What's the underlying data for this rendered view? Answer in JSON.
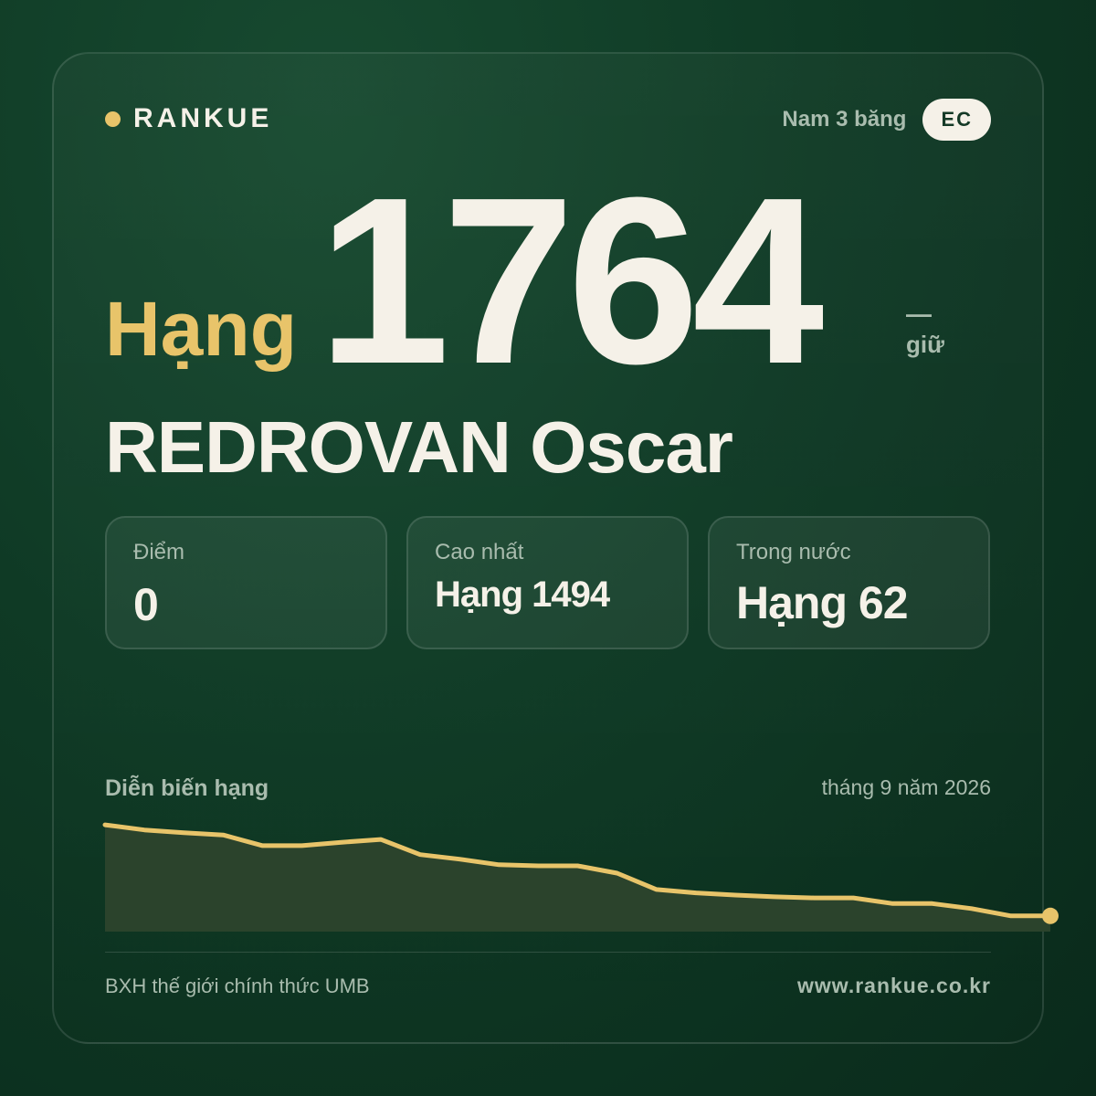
{
  "brand": {
    "name": "RANKUE",
    "dot_color": "#e8c46a"
  },
  "meta": {
    "category": "Nam 3 băng",
    "badge": "EC"
  },
  "rank": {
    "prefix": "Hạng",
    "number": "1764",
    "change_symbol": "—",
    "change_label": "giữ"
  },
  "player": {
    "name": "REDROVAN Oscar"
  },
  "stats": [
    {
      "label": "Điểm",
      "value": "0"
    },
    {
      "label": "Cao nhất",
      "value": "Hạng 1494"
    },
    {
      "label": "Trong nước",
      "value": "Hạng 62"
    }
  ],
  "chart": {
    "title": "Diễn biến hạng",
    "date": "tháng 9 năm 2026"
  },
  "chart_data": {
    "type": "area",
    "series": [
      {
        "values": [
          1,
          1.9,
          2.4,
          2.8,
          4.7,
          4.7,
          4.1,
          3.6,
          6.3,
          7.1,
          8.1,
          8.3,
          8.3,
          9.6,
          12.5,
          13.1,
          13.5,
          13.8,
          14.0,
          14.0,
          15.0,
          15.0,
          15.9,
          17.2,
          17.2
        ]
      }
    ],
    "accent_color": "#e8c46a",
    "fill_color": "#2b432c",
    "grid": false
  },
  "footer": {
    "source": "BXH thế giới chính thức UMB",
    "url": "www.rankue.co.kr"
  }
}
